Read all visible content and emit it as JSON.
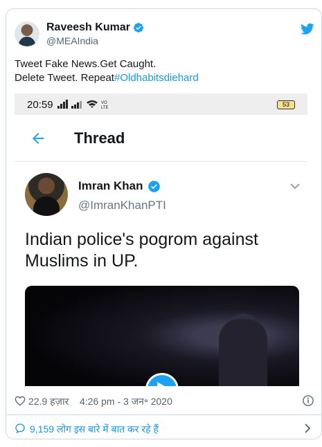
{
  "author": {
    "name": "Raveesh Kumar",
    "handle": "@MEAIndia",
    "verified": true
  },
  "tweet": {
    "line1": "Tweet Fake News.Get Caught.",
    "line2_prefix": "Delete Tweet. Repeat",
    "hashtag": "#Oldhabitsdiehard"
  },
  "embedded_screenshot": {
    "status_time": "20:59",
    "battery": "53",
    "thread_title": "Thread",
    "inner_author_name": "Imran Khan",
    "inner_author_handle": "@ImranKhanPTI",
    "inner_text": "Indian police's pogrom against Muslims in UP."
  },
  "footer": {
    "likes": "22.9 हज़ार",
    "timestamp": "4:26 pm - 3 जन॰ 2020",
    "conversation": "9,159 लोग इस बारे में बात कर रहे हैं"
  },
  "colors": {
    "accent": "#1da1f2",
    "link": "#1b95e0",
    "muted": "#536471"
  },
  "icons": [
    "verified-icon",
    "twitter-logo-icon",
    "back-arrow-icon",
    "chevron-down-icon",
    "play-icon",
    "heart-icon",
    "info-icon",
    "comment-icon",
    "chevron-right-icon"
  ]
}
